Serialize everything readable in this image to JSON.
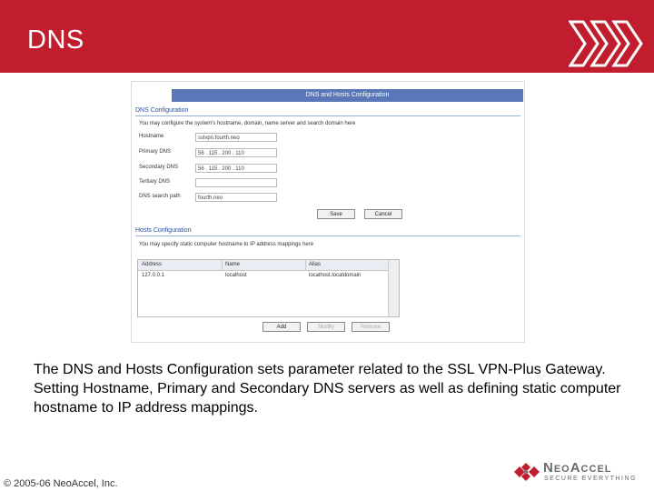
{
  "slide": {
    "title": "DNS",
    "caption": "The DNS and Hosts Configuration sets parameter related to the SSL VPN-Plus Gateway. Setting Hostname, Primary and Secondary DNS servers as well as defining static computer hostname to IP address mappings.",
    "copyright": "© 2005-06 NeoAccel, Inc.",
    "brand": "NeoAccel",
    "tagline": "SECURE EVERYTHING",
    "accent_color": "#c01e2e"
  },
  "screenshot": {
    "header": "DNS and Hosts Configuration",
    "dns_section": {
      "title": "DNS Configuration",
      "description": "You may configure the system's hostname, domain, name server and search domain here",
      "fields": [
        {
          "label": "Hostname",
          "value": "sslvpn.fourth.neo"
        },
        {
          "label": "Primary DNS",
          "value": "56 . 115 . 200 . 110"
        },
        {
          "label": "Secondary DNS",
          "value": "56 . 115 . 200 . 110"
        },
        {
          "label": "Tertiary DNS",
          "value": ""
        },
        {
          "label": "DNS search path",
          "value": "fourth.neo"
        }
      ],
      "save_label": "Save",
      "cancel_label": "Cancel"
    },
    "hosts_section": {
      "title": "Hosts Configuration",
      "description": "You may specify static computer hostname to IP address mappings here",
      "columns": [
        "Address",
        "Name",
        "Alias"
      ],
      "rows": [
        {
          "address": "127.0.0.1",
          "name": "localhost",
          "alias": "localhost.localdomain"
        }
      ],
      "add_label": "Add",
      "modify_label": "Modify",
      "remove_label": "Remove"
    }
  }
}
